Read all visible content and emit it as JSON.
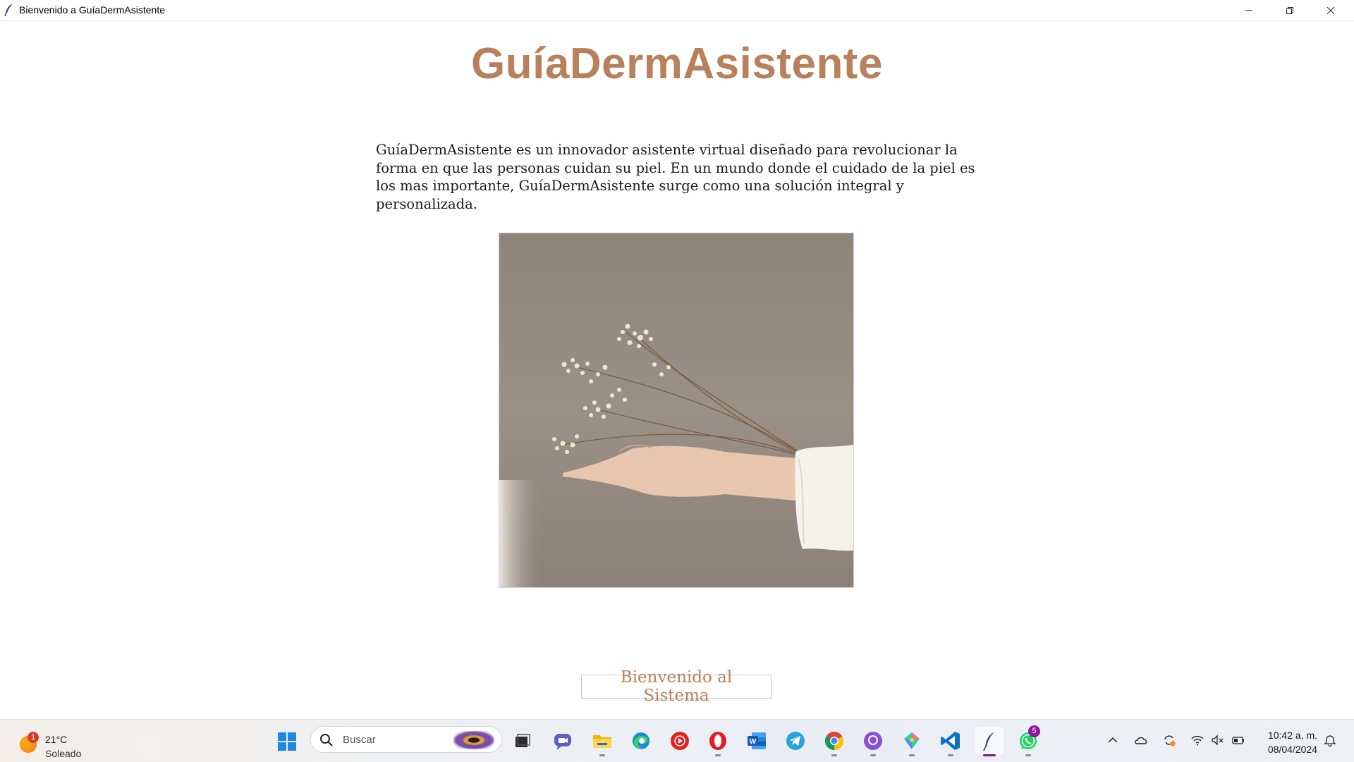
{
  "window": {
    "title": "Bienvenido a GuíaDermAsistente",
    "minimize_icon": "minimize-icon",
    "maximize_icon": "restore-icon",
    "close_icon": "close-icon"
  },
  "app": {
    "title": "GuíaDermAsistente",
    "description": "GuíaDermAsistente es un innovador asistente virtual diseñado para revolucionar la forma en que las personas cuidan su piel. En un mundo donde el cuidado de la piel es los mas importante, GuíaDermAsistente surge como una solución integral y personalizada.",
    "image_icon": "hand-holding-dried-flowers-photo",
    "button_label": "Bienvenido al Sistema",
    "accent_color": "#b9805c"
  },
  "taskbar": {
    "weather": {
      "badge": "1",
      "temp": "21°C",
      "condition": "Soleado"
    },
    "search_placeholder": "Buscar",
    "apps": [
      {
        "name": "start-icon"
      },
      {
        "name": "task-view-icon"
      },
      {
        "name": "chat-icon"
      },
      {
        "name": "file-explorer-icon"
      },
      {
        "name": "edge-icon"
      },
      {
        "name": "youtube-music-icon"
      },
      {
        "name": "opera-icon"
      },
      {
        "name": "word-icon"
      },
      {
        "name": "telegram-icon"
      },
      {
        "name": "chrome-icon"
      },
      {
        "name": "github-desktop-icon"
      },
      {
        "name": "gitkraken-icon"
      },
      {
        "name": "vscode-icon"
      },
      {
        "name": "python-tk-icon"
      },
      {
        "name": "whatsapp-icon",
        "badge": "5"
      }
    ],
    "clock": {
      "time": "10:42 a. m.",
      "date": "08/04/2024"
    }
  }
}
